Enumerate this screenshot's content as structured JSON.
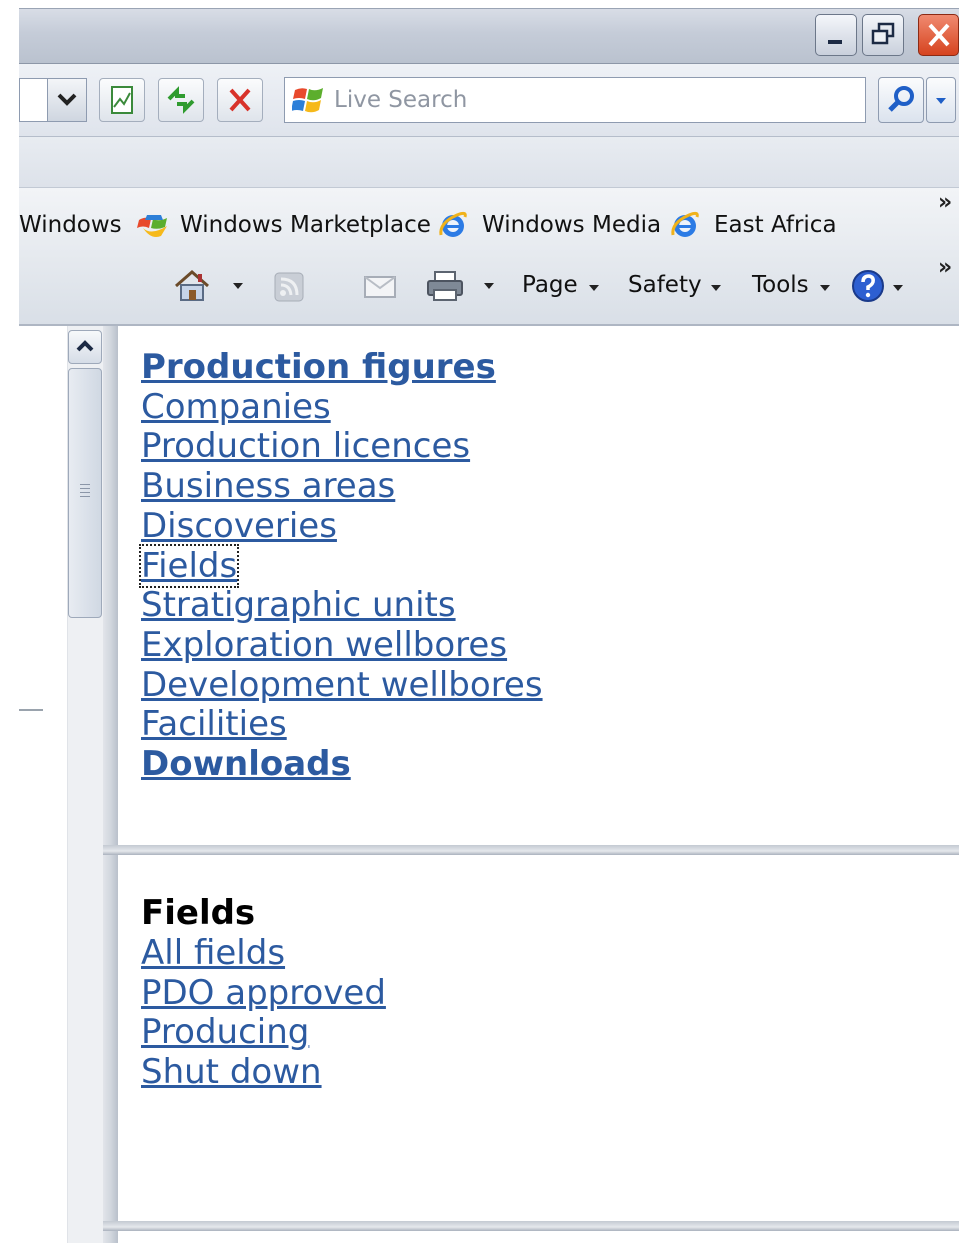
{
  "browser": {
    "search": {
      "placeholder": "Live Search"
    },
    "links_bar": {
      "items": [
        {
          "label": "Windows"
        },
        {
          "label": "Windows Marketplace"
        },
        {
          "label": "Windows Media"
        },
        {
          "label": "East Africa"
        }
      ],
      "overflow": "»"
    },
    "command_bar": {
      "page_label": "Page",
      "safety_label": "Safety",
      "tools_label": "Tools",
      "overflow": "»"
    }
  },
  "nav_frame": {
    "links": [
      {
        "label": "Production figures",
        "bold": true
      },
      {
        "label": "Companies"
      },
      {
        "label": "Production licences"
      },
      {
        "label": "Business areas"
      },
      {
        "label": "Discoveries"
      },
      {
        "label": "Fields",
        "focused": true
      },
      {
        "label": "Stratigraphic units"
      },
      {
        "label": "Exploration wellbores"
      },
      {
        "label": "Development wellbores"
      },
      {
        "label": "Facilities"
      },
      {
        "label": "Downloads",
        "bold": true
      }
    ]
  },
  "sub_frame": {
    "heading": "Fields",
    "links": [
      {
        "label": "All fields"
      },
      {
        "label": "PDO approved"
      },
      {
        "label": "Producing"
      },
      {
        "label": "Shut down"
      }
    ]
  },
  "colors": {
    "link": "#2c5aa0",
    "chrome": "#dde2ea"
  }
}
